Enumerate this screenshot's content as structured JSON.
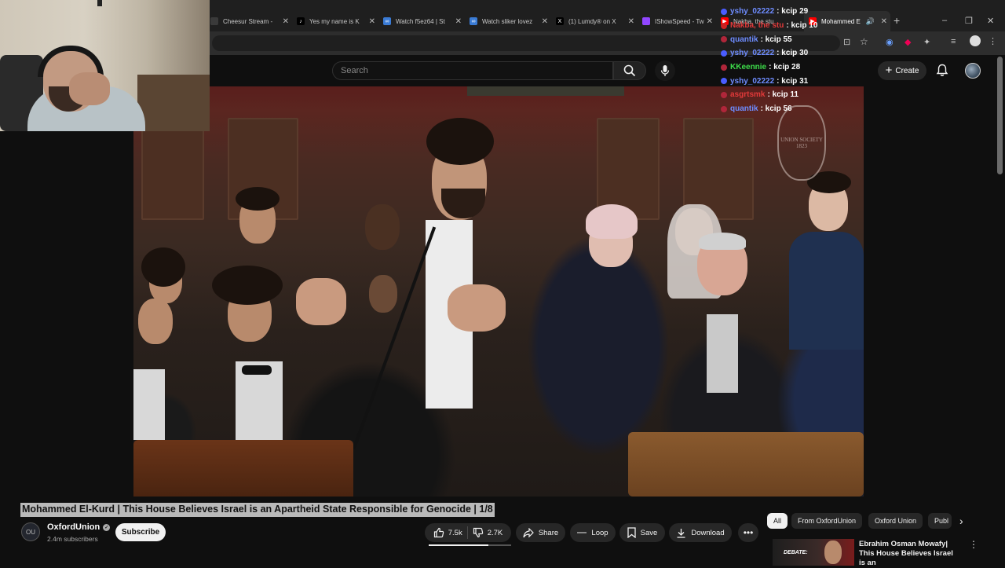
{
  "browser": {
    "tabs": [
      {
        "label": "Cheesur Stream -",
        "icon": "generic-icon",
        "color": "#3a3a3a"
      },
      {
        "label": "Yes my name is K",
        "icon": "tiktok-icon",
        "color": "#000000"
      },
      {
        "label": "Watch f5ez64 | St",
        "icon": "stream-icon",
        "color": "#3a7bd5"
      },
      {
        "label": "Watch sliker lovez",
        "icon": "stream-icon",
        "color": "#3a7bd5"
      },
      {
        "label": "(1) Lumdy® on X",
        "icon": "x-icon",
        "color": "#000000"
      },
      {
        "label": "IShowSpeed - Tw",
        "icon": "twitch-icon",
        "color": "#9146ff"
      },
      {
        "label": "Nakba, the stu",
        "icon": "youtube-icon",
        "color": "#ff0000"
      },
      {
        "label": "Mohammed E",
        "icon": "youtube-icon",
        "color": "#ff0000"
      }
    ],
    "new_tab": "+",
    "win_controls": [
      "–",
      "❐",
      "✕"
    ]
  },
  "youtube": {
    "search_placeholder": "Search",
    "create_label": "Create",
    "video_title": "Mohammed El-Kurd | This House Believes Israel is an Apartheid State Responsible for Genocide | 1/8",
    "channel": {
      "name": "OxfordUnion",
      "subscribers": "2.4m subscribers",
      "avatar_text": "OU"
    },
    "subscribe_label": "Subscribe",
    "actions": {
      "likes": "7.5k",
      "dislikes": "2.7K",
      "share": "Share",
      "loop": "Loop",
      "save": "Save",
      "download": "Download",
      "like_ratio": 0.72
    },
    "chips": [
      "All",
      "From OxfordUnion",
      "Oxford Union",
      "Publ"
    ],
    "recommendation": {
      "thumb_text": "DEBATE:",
      "title": "Ebrahim Osman Mowafy| This House Believes Israel is an"
    },
    "video_overlay": {
      "crest_text": "UNION SOCIETY 1823"
    }
  },
  "chat": [
    {
      "user": "yshy_02222",
      "message": "kcip 29",
      "color": "#6e8cff",
      "badge": "#4a5cff"
    },
    {
      "user": "Nakba, the stu",
      "message": "kcip 10",
      "color": "#e23a3a",
      "badge": "#cc2222"
    },
    {
      "user": "quantik",
      "message": "kcip 55",
      "color": "#6e8cff",
      "badge": "#b0263a"
    },
    {
      "user": "yshy_02222",
      "message": "kcip 30",
      "color": "#6e8cff",
      "badge": "#4a5cff"
    },
    {
      "user": "KKeennie",
      "message": "kcip 28",
      "color": "#3ddc4a",
      "badge": "#b0263a"
    },
    {
      "user": "yshy_02222",
      "message": "kcip 31",
      "color": "#6e8cff",
      "badge": "#4a5cff"
    },
    {
      "user": "asgrtsmk",
      "message": "kcip 11",
      "color": "#e23a3a",
      "badge": "#b0263a"
    },
    {
      "user": "quantik",
      "message": "kcip 56",
      "color": "#6e8cff",
      "badge": "#b0263a"
    }
  ]
}
